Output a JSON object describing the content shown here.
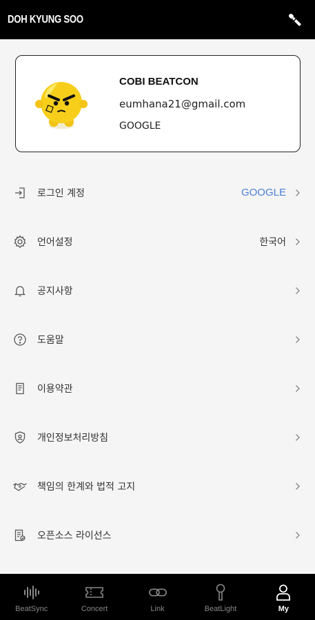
{
  "header": {
    "title": "DOH KYUNG SOO",
    "mic_icon": "microphone-icon"
  },
  "profile": {
    "name": "COBI BEATCON",
    "email": "eumhana21@gmail.com",
    "provider": "GOOGLE"
  },
  "menu": [
    {
      "icon": "login-icon",
      "label": "로그인 계정",
      "value": "GOOGLE"
    },
    {
      "icon": "gear-icon",
      "label": "언어설정",
      "value": "한국어"
    },
    {
      "icon": "bell-icon",
      "label": "공지사항",
      "value": ""
    },
    {
      "icon": "help-icon",
      "label": "도움말",
      "value": ""
    },
    {
      "icon": "document-icon",
      "label": "이용약관",
      "value": ""
    },
    {
      "icon": "shield-icon",
      "label": "개인정보처리방침",
      "value": ""
    },
    {
      "icon": "handshake-icon",
      "label": "책임의 한계와 법적 고지",
      "value": ""
    },
    {
      "icon": "license-icon",
      "label": "오픈소스 라이선스",
      "value": ""
    }
  ],
  "tabs": [
    {
      "icon": "waveform-icon",
      "label": "BeatSync",
      "active": false
    },
    {
      "icon": "ticket-icon",
      "label": "Concert",
      "active": false
    },
    {
      "icon": "link-icon",
      "label": "Link",
      "active": false
    },
    {
      "icon": "lightstick-icon",
      "label": "BeatLight",
      "active": false
    },
    {
      "icon": "person-icon",
      "label": "My",
      "active": true
    }
  ],
  "colors": {
    "accent": "#4a7fd6",
    "header_bg": "#000000",
    "page_bg": "#f5f5f5"
  }
}
